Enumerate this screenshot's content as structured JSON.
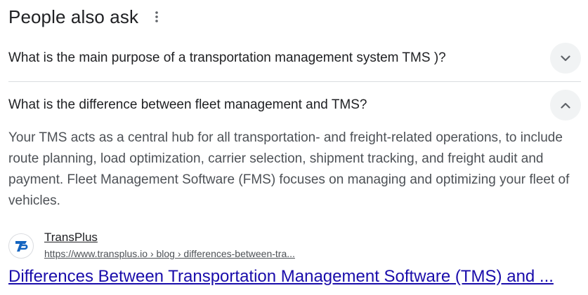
{
  "header": {
    "title": "People also ask",
    "more_icon": "more-vert-icon"
  },
  "questions": [
    {
      "text": "What is the main purpose of a transportation management system TMS )?",
      "expanded": false,
      "icon": "chevron-down-icon"
    },
    {
      "text": "What is the difference between fleet management and TMS?",
      "expanded": true,
      "icon": "chevron-up-icon"
    }
  ],
  "answer": {
    "text": "Your TMS acts as a central hub for all transportation- and freight-related operations, to include route planning, load optimization, carrier selection, shipment tracking, and freight audit and payment. Fleet Management Software (FMS) focuses on managing and optimizing your fleet of vehicles."
  },
  "source": {
    "name": "TransPlus",
    "url": "https://www.transplus.io › blog › differences-between-tra...",
    "favicon": "transplus-logo-icon"
  },
  "result_link": {
    "text": "Differences Between Transportation Management Software (TMS) and ..."
  },
  "colors": {
    "link": "#1a0dab",
    "text": "#202124",
    "muted": "#4d5156",
    "chevron_bg": "#f1f3f4",
    "brand": "#1565c0"
  }
}
